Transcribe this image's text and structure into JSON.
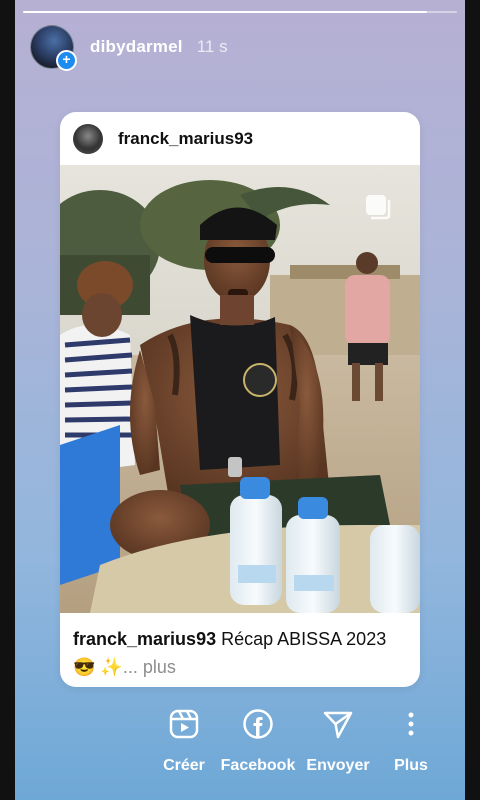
{
  "story": {
    "progress": 0.93,
    "username": "dibydarmel",
    "timestamp": "11 s",
    "add_badge": "+"
  },
  "post": {
    "author": "franck_marius93",
    "caption_user": "franck_marius93",
    "caption_text": " Récap ABISSA 2023😎 ✨",
    "more": "... plus",
    "multi_icon": "carousel-icon"
  },
  "actions": [
    {
      "label": "Créer",
      "icon": "reels-icon"
    },
    {
      "label": "Facebook",
      "icon": "facebook-icon"
    },
    {
      "label": "Envoyer",
      "icon": "send-icon"
    },
    {
      "label": "Plus",
      "icon": "more-vertical-icon"
    }
  ],
  "colors": {
    "badge": "#1d8cf0",
    "background_top": "#b6b0d3",
    "background_bottom": "#6ea8d6"
  }
}
